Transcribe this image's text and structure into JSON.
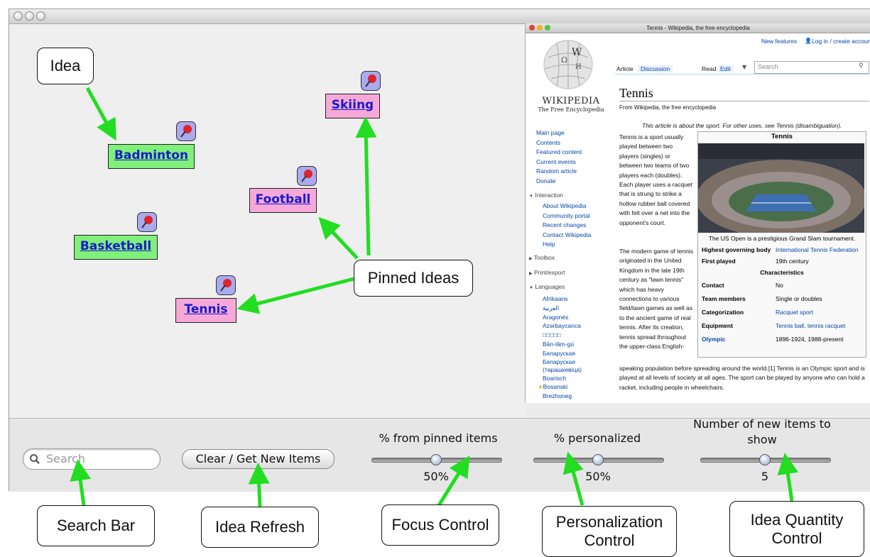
{
  "app": {
    "search": {
      "placeholder": "Search"
    },
    "refresh_button": "Clear / Get New Items",
    "sliders": [
      {
        "label": "% from pinned items",
        "value_text": "50%",
        "value": 0.5
      },
      {
        "label": "% personalized",
        "value_text": "50%",
        "value": 0.5
      },
      {
        "label": "Number of new items to show",
        "value_text": "5",
        "value": 0.5
      }
    ]
  },
  "ideas": [
    {
      "label": "Badminton",
      "kind": "idea",
      "color": "#7ff07a",
      "pinned": true
    },
    {
      "label": "Basketball",
      "kind": "idea",
      "color": "#7ff07a",
      "pinned": true
    },
    {
      "label": "Skiing",
      "kind": "pinned-idea",
      "color": "#f6a9d8",
      "pinned": true
    },
    {
      "label": "Football",
      "kind": "pinned-idea",
      "color": "#f6a9d8",
      "pinned": true
    },
    {
      "label": "Tennis",
      "kind": "pinned-idea",
      "color": "#f6a9d8",
      "pinned": true
    }
  ],
  "callouts": {
    "idea": "Idea",
    "pinned_ideas": "Pinned Ideas",
    "search_bar": "Search Bar",
    "idea_refresh": "Idea Refresh",
    "focus_control": "Focus Control",
    "personalization_control": "Personalization Control",
    "idea_quantity_control": "Idea Quantity Control"
  },
  "arrow_color": "#22dd22",
  "browser": {
    "window_title": "Tennis - Wikipedia, the free encyclopedia",
    "top_links": [
      "New features",
      "Log in / create account"
    ],
    "tabs": [
      "Article",
      "Discussion"
    ],
    "view_tabs": [
      "Read",
      "Edit"
    ],
    "search_placeholder": "Search",
    "wordmark": "WIKIPEDIA",
    "wordmark_sub": "The Free Encyclopedia",
    "nav_main": [
      "Main page",
      "Contents",
      "Featured content",
      "Current events",
      "Random article",
      "Donate"
    ],
    "interaction_heading": "Interaction",
    "nav_interaction": [
      "About Wikipedia",
      "Community portal",
      "Recent changes",
      "Contact Wikipedia",
      "Help"
    ],
    "toolbox": "Toolbox",
    "print_export": "Print/export",
    "languages_heading": "Languages",
    "languages": [
      "Afrikaans",
      "العربية",
      "Aragonés",
      "Azərbaycanca",
      "□□□□□",
      "Bân-lâm-gú",
      "Беларуская",
      "Беларуская (тарашкевіца)",
      "Boarisch",
      "Bosanski",
      "Brezhoneg"
    ],
    "article_title": "Tennis",
    "from_line": "From Wikipedia, the free encyclopedia",
    "hatnote": "This article is about the sport. For other uses, see Tennis (disambiguation).",
    "infobox": {
      "title": "Tennis",
      "caption": "The US Open is a prestigious Grand Slam tournament.",
      "rows": [
        {
          "k": "Highest governing body",
          "v": "International Tennis Federation"
        },
        {
          "k": "First played",
          "v": "19th century"
        }
      ],
      "section": "Characteristics",
      "rows2": [
        {
          "k": "Contact",
          "v": "No"
        },
        {
          "k": "Team members",
          "v": "Single or doubles"
        },
        {
          "k": "Categorization",
          "v": "Racquet sport"
        },
        {
          "k": "Equipment",
          "v": "Tennis ball, tennis racquet"
        },
        {
          "k": "Olympic",
          "v": "1896-1924, 1988-present"
        }
      ]
    },
    "para1": "Tennis is a sport usually played between two players (singles) or between two teams of two players each (doubles). Each player uses a racquet that is strung to strike a hollow rubber ball covered with felt over a net into the opponent's court.",
    "para2": "The modern game of tennis originated in the United Kingdom in the late 19th century as \"lawn tennis\" which has heavy connections to various field/lawn games as well as to the ancient game of real tennis. After its creation, tennis spread throughout the upper-class English-",
    "para3": "speaking population before spreading around the world.[1] Tennis is an Olympic sport and is played at all levels of society at all ages. The sport can be played by anyone who can hold a racket, including people in wheelchairs."
  }
}
